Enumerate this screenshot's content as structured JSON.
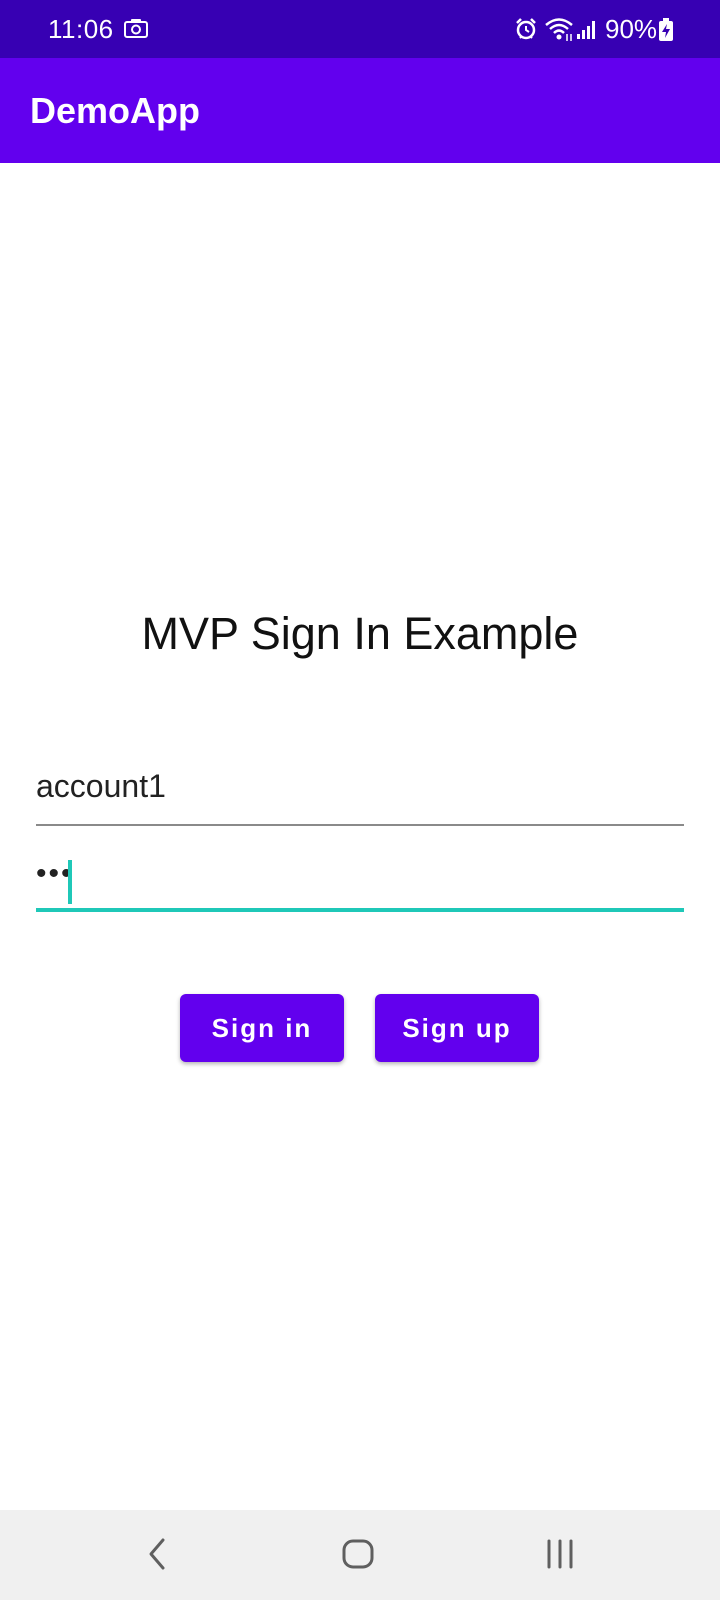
{
  "status_bar": {
    "time": "11:06",
    "battery": "90%",
    "icons": [
      "camera-icon",
      "alarm-icon",
      "wifi-icon",
      "signal-icon",
      "battery-charging-icon"
    ],
    "color": "#3700b3"
  },
  "app_bar": {
    "title": "DemoApp",
    "color": "#6200ee"
  },
  "main": {
    "heading": "MVP Sign In Example",
    "username": {
      "value": "account1"
    },
    "password": {
      "value": "•••",
      "accent_color": "#1fc8b8"
    },
    "buttons": {
      "sign_in": "Sign in",
      "sign_up": "Sign up",
      "color": "#6200ee"
    }
  },
  "nav_bar": {
    "icons": [
      "back-icon",
      "home-icon",
      "recents-icon"
    ]
  }
}
